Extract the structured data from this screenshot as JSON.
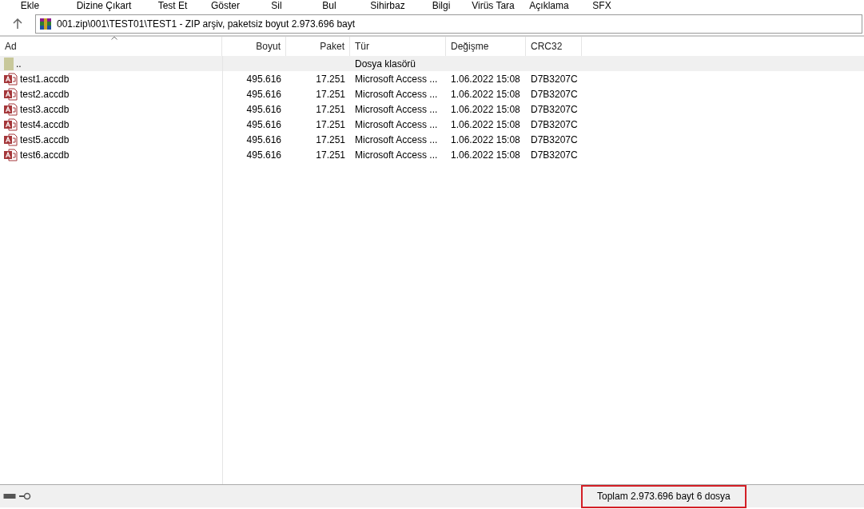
{
  "toolbar": [
    "Ekle",
    "Dizine Çıkart",
    "Test Et",
    "Göster",
    "Sil",
    "Bul",
    "Sihirbaz",
    "Bilgi",
    "Virüs Tara",
    "Açıklama",
    "SFX"
  ],
  "address": {
    "path": "001.zip\\001\\TEST01\\TEST1 - ZIP arşiv, paketsiz boyut 2.973.696 bayt"
  },
  "columns": [
    {
      "label": "Ad",
      "sorted": true
    },
    {
      "label": "Boyut",
      "sorted": false
    },
    {
      "label": "Paket",
      "sorted": false
    },
    {
      "label": "Tür",
      "sorted": false
    },
    {
      "label": "Değişme",
      "sorted": false
    },
    {
      "label": "CRC32",
      "sorted": false
    }
  ],
  "rows": [
    {
      "kind": "folder",
      "cells": [
        "..",
        "",
        "",
        "Dosya klasörü",
        "",
        ""
      ]
    },
    {
      "kind": "access",
      "cells": [
        "test1.accdb",
        "495.616",
        "17.251",
        "Microsoft Access ...",
        "1.06.2022 15:08",
        "D7B3207C"
      ]
    },
    {
      "kind": "access",
      "cells": [
        "test2.accdb",
        "495.616",
        "17.251",
        "Microsoft Access ...",
        "1.06.2022 15:08",
        "D7B3207C"
      ]
    },
    {
      "kind": "access",
      "cells": [
        "test3.accdb",
        "495.616",
        "17.251",
        "Microsoft Access ...",
        "1.06.2022 15:08",
        "D7B3207C"
      ]
    },
    {
      "kind": "access",
      "cells": [
        "test4.accdb",
        "495.616",
        "17.251",
        "Microsoft Access ...",
        "1.06.2022 15:08",
        "D7B3207C"
      ]
    },
    {
      "kind": "access",
      "cells": [
        "test5.accdb",
        "495.616",
        "17.251",
        "Microsoft Access ...",
        "1.06.2022 15:08",
        "D7B3207C"
      ]
    },
    {
      "kind": "access",
      "cells": [
        "test6.accdb",
        "495.616",
        "17.251",
        "Microsoft Access ...",
        "1.06.2022 15:08",
        "D7B3207C"
      ]
    }
  ],
  "status_bar": {
    "total": "Toplam 2.973.696 bayt 6 dosya",
    "highlighted": true
  }
}
